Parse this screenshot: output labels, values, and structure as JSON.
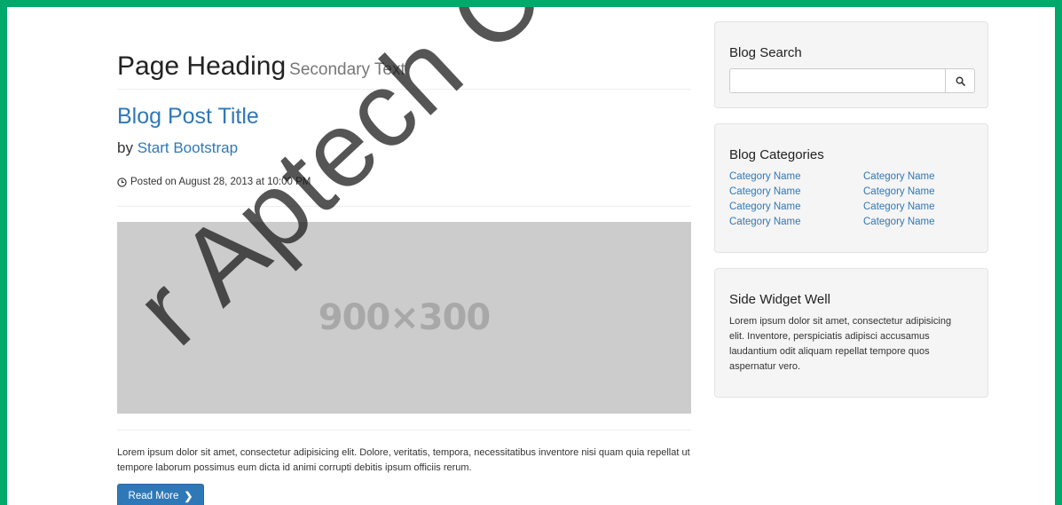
{
  "header": {
    "page_heading": "Page Heading",
    "secondary_text": "Secondary Text"
  },
  "post": {
    "title": "Blog Post Title",
    "by_prefix": "by",
    "author": "Start Bootstrap",
    "posted": "Posted on August 28, 2013 at 10:00 PM",
    "image_label": "900×300",
    "body": "Lorem ipsum dolor sit amet, consectetur adipisicing elit. Dolore, veritatis, tempora, necessitatibus inventore nisi quam quia repellat ut tempore laborum possimus eum dicta id animi corrupti debitis ipsum officiis rerum.",
    "read_more": "Read More"
  },
  "sidebar": {
    "search": {
      "title": "Blog Search",
      "value": "",
      "icon": "search-icon"
    },
    "categories": {
      "title": "Blog Categories",
      "left": [
        "Category Name",
        "Category Name",
        "Category Name",
        "Category Name"
      ],
      "right": [
        "Category Name",
        "Category Name",
        "Category Name",
        "Category Name"
      ]
    },
    "widget": {
      "title": "Side Widget Well",
      "text": "Lorem ipsum dolor sit amet, consectetur adipisicing elit. Inventore, perspiciatis adipisci accusamus laudantium odit aliquam repellat tempore quos aspernatur vero."
    }
  },
  "watermark": {
    "text": "r Aptech Centre"
  },
  "colors": {
    "frame": "#00a86b",
    "link": "#2f78b8",
    "button": "#2f78b8",
    "well": "#f5f5f5",
    "placeholder": "#cccccc"
  }
}
